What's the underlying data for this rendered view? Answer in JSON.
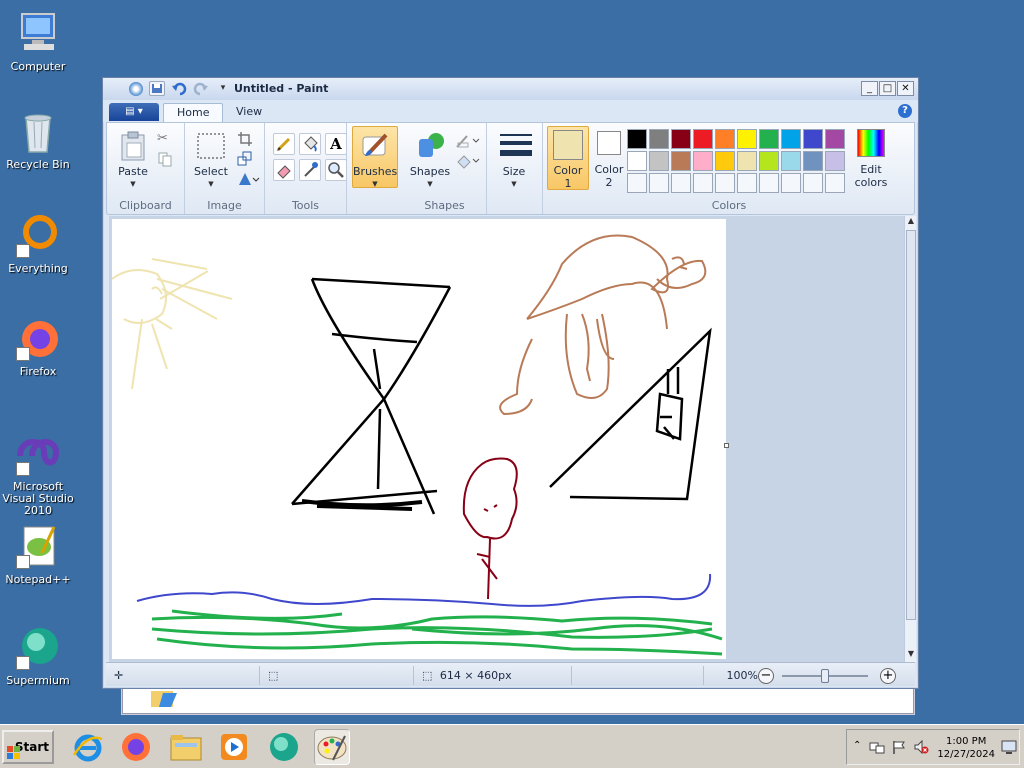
{
  "desktop": {
    "icons": [
      {
        "label": "Computer"
      },
      {
        "label": "Recycle Bin"
      },
      {
        "label": "Everything"
      },
      {
        "label": "Firefox"
      },
      {
        "label": "Microsoft Visual Studio 2010"
      },
      {
        "label": "Notepad++"
      },
      {
        "label": "Supermium"
      }
    ]
  },
  "window": {
    "title": "Untitled - Paint",
    "tabs": [
      {
        "label": "Home"
      },
      {
        "label": "View"
      }
    ],
    "help": "?",
    "controls": {
      "minimize": "_",
      "maximize": "□",
      "close": "✕"
    }
  },
  "ribbon": {
    "clipboard": {
      "group": "Clipboard",
      "paste": "Paste"
    },
    "image": {
      "group": "Image",
      "select": "Select"
    },
    "tools": {
      "group": "Tools"
    },
    "brushes": {
      "label": "Brushes"
    },
    "shapes": {
      "group": "Shapes",
      "label": "Shapes"
    },
    "size": {
      "label": "Size"
    },
    "colors": {
      "group": "Colors",
      "color1_label": "Color",
      "color1_num": "1",
      "color2_label": "Color",
      "color2_num": "2",
      "edit_label": "Edit",
      "edit_label2": "colors",
      "color1": "#efe4b0",
      "color2": "#ffffff",
      "palette_row1": [
        "#000000",
        "#7f7f7f",
        "#880015",
        "#ed1c24",
        "#ff7f27",
        "#fff200",
        "#22b14c",
        "#00a2e8",
        "#3f48cc",
        "#a349a4"
      ],
      "palette_row2": [
        "#ffffff",
        "#c3c3c3",
        "#b97a57",
        "#ffaec9",
        "#ffc90e",
        "#efe4b0",
        "#b5e61d",
        "#99d9ea",
        "#7092be",
        "#c8bfe7"
      ]
    }
  },
  "status": {
    "size": "614 × 460px",
    "zoom": "100%",
    "zoom_fraction": 0.5
  },
  "taskbar": {
    "start": "Start",
    "time": "1:00 PM",
    "date": "12/27/2024"
  }
}
